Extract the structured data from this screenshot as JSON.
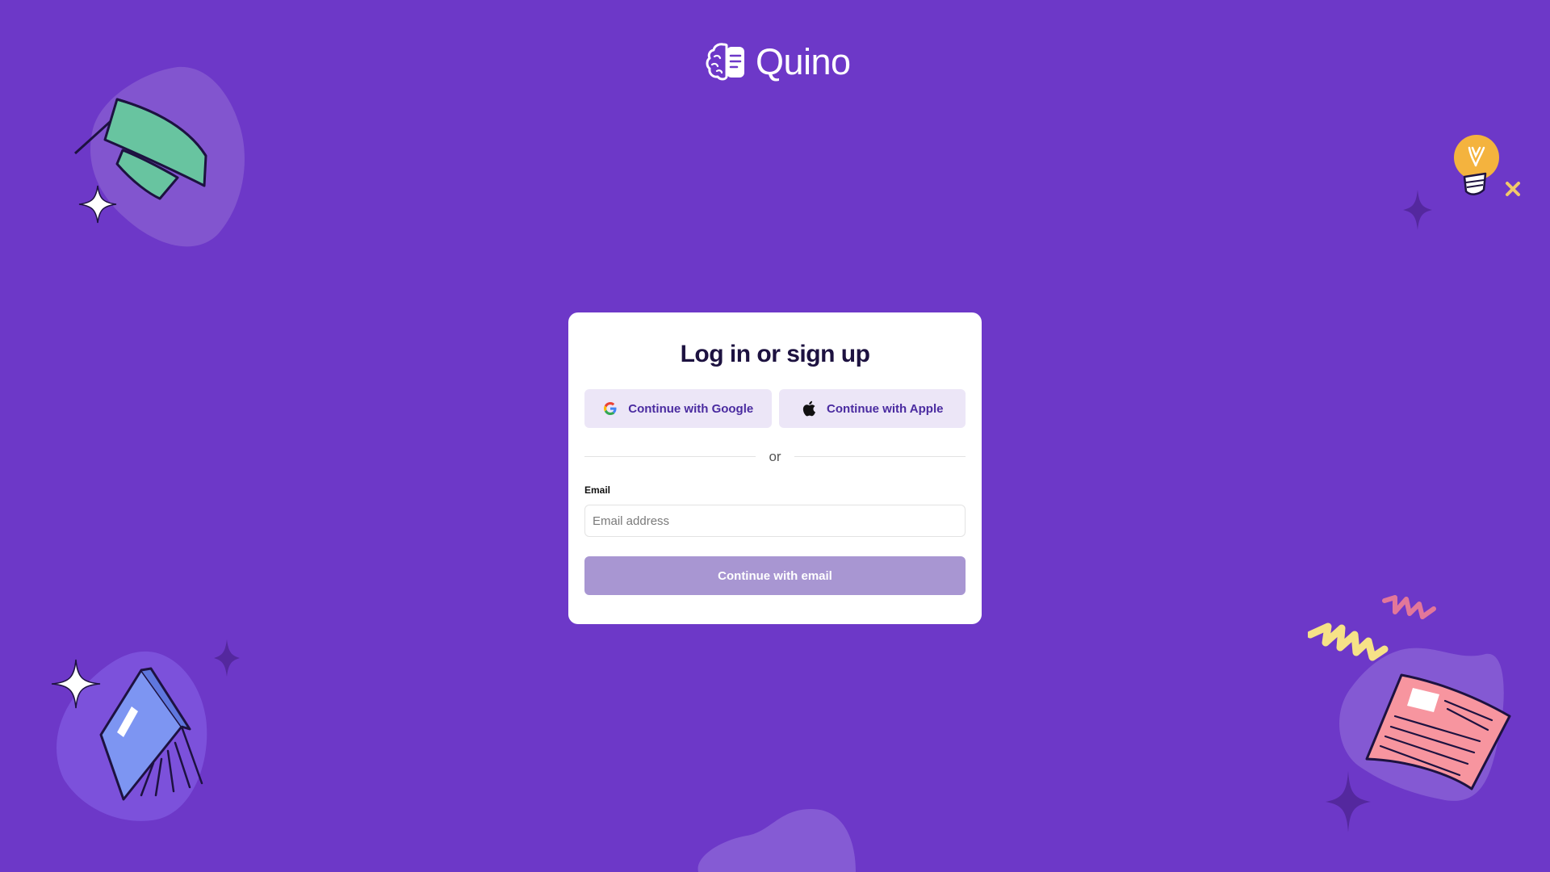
{
  "brand": {
    "name": "Quino",
    "logo_icon": "brain-document-icon"
  },
  "card": {
    "title": "Log in or sign up",
    "google_button": "Continue with Google",
    "apple_button": "Continue with Apple",
    "divider": "or",
    "email_label": "Email",
    "email_placeholder": "Email address",
    "email_value": "",
    "submit_button": "Continue with email"
  },
  "colors": {
    "background": "#6d38c8",
    "card": "#ffffff",
    "social_button_bg": "#ece6f7",
    "social_button_text": "#4a2ba0",
    "submit_button_bg": "#a896d2",
    "title_text": "#1d1240"
  },
  "decorations": [
    "graduation-cap-icon",
    "lightbulb-icon",
    "book-icon",
    "paper-document-icon",
    "sparkle-icon",
    "squiggle-icon"
  ]
}
